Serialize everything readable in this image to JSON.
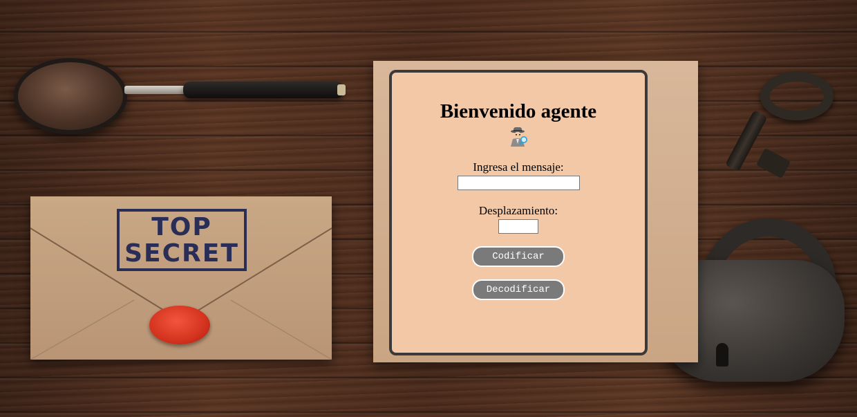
{
  "background": {
    "stamp_line1": "TOP",
    "stamp_line2": "SECRET"
  },
  "card": {
    "title": "Bienvenido agente",
    "icon": "detective-icon",
    "message_label": "Ingresa el mensaje:",
    "message_value": "",
    "shift_label": "Desplazamiento:",
    "shift_value": "",
    "encode_label": "Codificar",
    "decode_label": "Decodificar"
  },
  "colors": {
    "card_background": "#f2c8a7",
    "card_border": "#3c3a39",
    "button_background": "#7a7a7a",
    "button_text": "#ffffff"
  }
}
